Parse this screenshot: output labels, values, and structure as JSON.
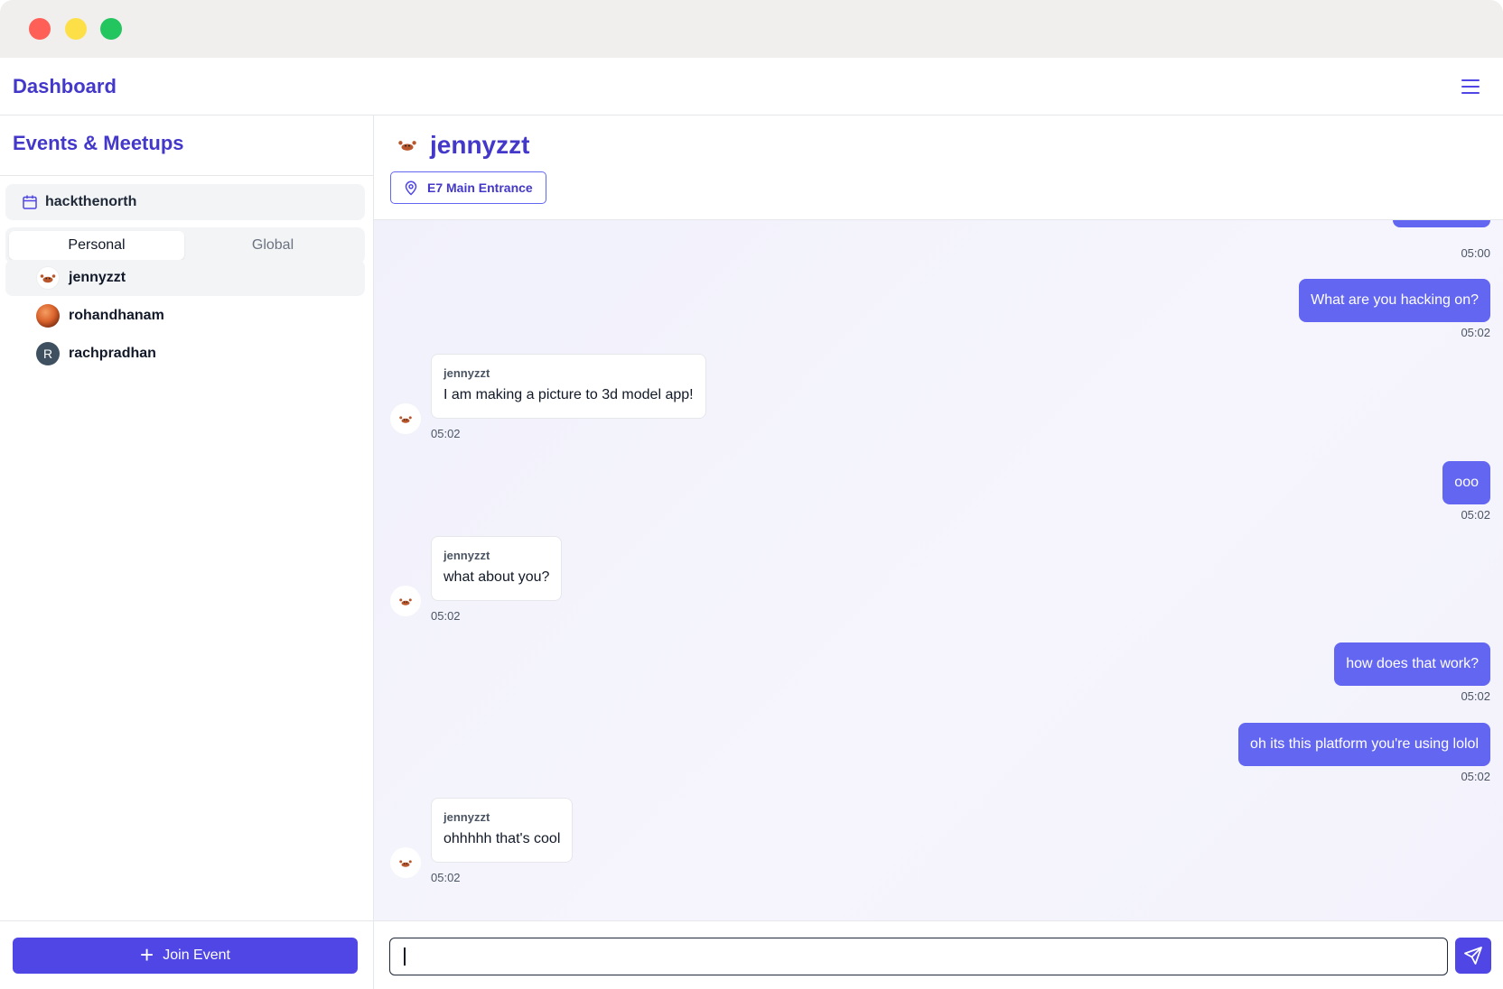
{
  "window": {
    "controls": [
      "close",
      "minimize",
      "maximize"
    ]
  },
  "appbar": {
    "title": "Dashboard",
    "menu_icon": "hamburger-menu-icon"
  },
  "sidebar": {
    "title": "Events & Meetups",
    "event": {
      "name": "hackthenorth",
      "icon": "calendar-icon"
    },
    "tabs": [
      {
        "label": "Personal",
        "active": true
      },
      {
        "label": "Global",
        "active": false
      }
    ],
    "contacts": [
      {
        "name": "jennyzzt",
        "avatar": "crab-emoji",
        "selected": true
      },
      {
        "name": "rohandhanam",
        "avatar": "photo"
      },
      {
        "name": "rachpradhan",
        "avatar": "letter",
        "initial": "R"
      }
    ],
    "join_label": "Join Event"
  },
  "chat": {
    "header": {
      "name": "jennyzzt",
      "location": "E7 Main Entrance",
      "location_icon": "map-pin-icon"
    },
    "messages": [
      {
        "direction": "out",
        "text": "",
        "time": "05:00"
      },
      {
        "direction": "out",
        "text": "What are you hacking on?",
        "time": "05:02"
      },
      {
        "direction": "in",
        "sender": "jennyzzt",
        "text": "I am making a picture to 3d model app!",
        "time": "05:02"
      },
      {
        "direction": "out",
        "text": "ooo",
        "time": "05:02"
      },
      {
        "direction": "in",
        "sender": "jennyzzt",
        "text": "what about you?",
        "time": "05:02"
      },
      {
        "direction": "out",
        "text": "how does that work?",
        "time": "05:02"
      },
      {
        "direction": "out",
        "text": "oh its this platform you're using lolol",
        "time": "05:02"
      },
      {
        "direction": "in",
        "sender": "jennyzzt",
        "text": "ohhhhh that's cool",
        "time": "05:02"
      }
    ],
    "composer": {
      "value": "",
      "placeholder": "",
      "send_icon": "send-icon"
    }
  },
  "colors": {
    "accent": "#4f46e5",
    "accent_text": "#4338ca",
    "bubble_out": "#6366f1",
    "chat_bg": "#f3f2fc"
  }
}
